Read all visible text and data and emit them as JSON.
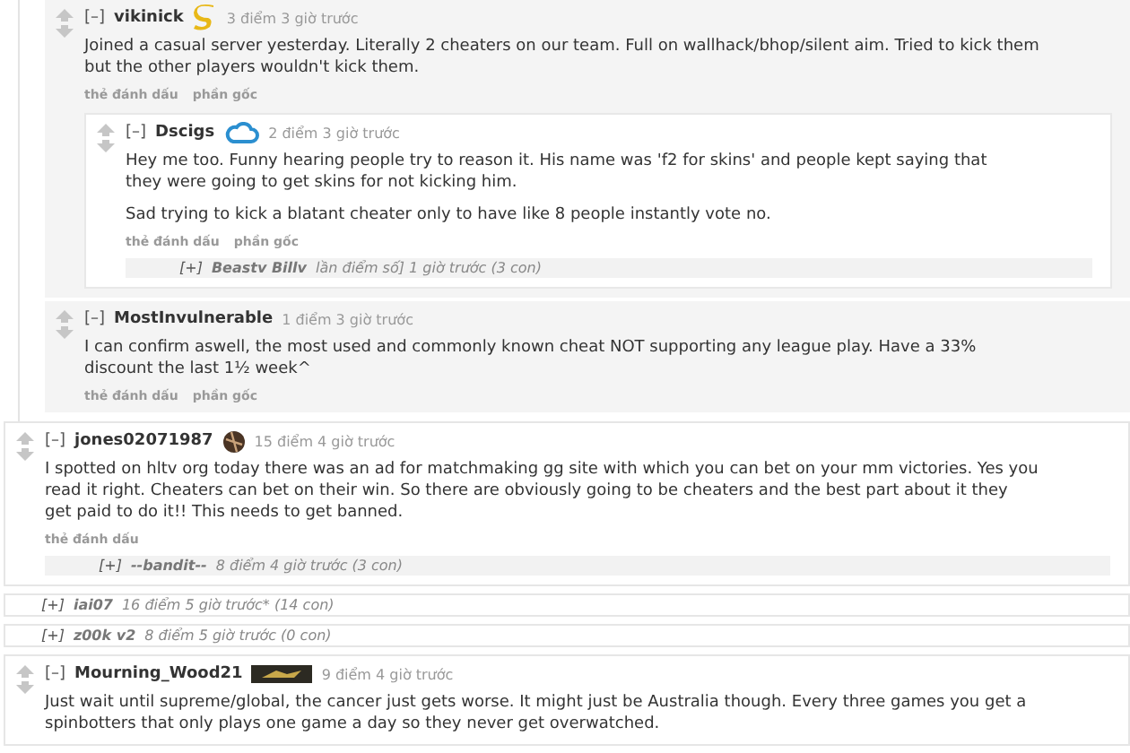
{
  "continued_thread": {
    "children": [
      {
        "kind": "comment",
        "toggle": "[–]",
        "author": "vikinick",
        "flair": {
          "kind": "s-mark"
        },
        "meta": "3 điểm 3 giờ trước",
        "body": [
          "Joined a casual server yesterday. Literally 2 cheaters on our team. Full on wallhack/bhop/silent aim. Tried to kick them but the other players wouldn't kick them."
        ],
        "actions": [
          "thẻ đánh dấu",
          "phần gốc"
        ],
        "children": [
          {
            "kind": "comment",
            "toggle": "[–]",
            "author": "Dscigs",
            "flair": {
              "kind": "cloud"
            },
            "meta": "2 điểm 3 giờ trước",
            "body": [
              "Hey me too. Funny hearing people try to reason it. His name was 'f2 for skins' and people kept saying that they were going to get skins for not kicking him.",
              "Sad trying to kick a blatant cheater only to have like 8 people instantly vote no."
            ],
            "actions": [
              "thẻ đánh dấu",
              "phần gốc"
            ],
            "children": [
              {
                "kind": "collapsed",
                "toggle": "[+]",
                "author": "Beastv  Billv",
                "meta": "lần điểm số] 1 giờ trước (3 con)"
              }
            ]
          }
        ]
      },
      {
        "kind": "comment",
        "toggle": "[–]",
        "author": "MostInvulnerable",
        "meta": "1 điểm 3 giờ trước",
        "body": [
          "I can confirm aswell, the most used and commonly known cheat NOT supporting any league play. Have a 33% discount the last 1½ week^"
        ],
        "actions": [
          "thẻ đánh dấu",
          "phần gốc"
        ]
      }
    ]
  },
  "comments": [
    {
      "kind": "comment",
      "toggle": "[–]",
      "author": "jones02071987",
      "flair": {
        "kind": "ball"
      },
      "meta": "15 điểm 4 giờ trước",
      "body": [
        "I spotted on hltv org today there was an ad for matchmaking gg site with which you can bet on your mm victories. Yes you read it right. Cheaters can bet on their win. So there are obviously going to be cheaters and the best part about it they get paid to do it!! This needs to get banned."
      ],
      "actions": [
        "thẻ đánh dấu"
      ],
      "children": [
        {
          "kind": "collapsed",
          "toggle": "[+]",
          "author": "--bandit--",
          "meta": "8 điểm 4 giờ trước (3 con)"
        }
      ]
    },
    {
      "kind": "collapsed",
      "toggle": "[+]",
      "author": "iai07",
      "meta": "16 điểm 5 giờ trước* (14 con)"
    },
    {
      "kind": "collapsed",
      "toggle": "[+]",
      "author": "z00k  v2",
      "meta": "8 điểm 5 giờ trước (0 con)"
    },
    {
      "kind": "comment",
      "toggle": "[–]",
      "author": "Mourning_Wood21",
      "flair": {
        "kind": "badge"
      },
      "meta": "9 điểm 4 giờ trước",
      "body": [
        "Just wait until supreme/global, the cancer just gets worse. It might just be Australia though. Every three games you get a spinbotters that only plays one game a day so they never get overwatched."
      ]
    }
  ]
}
